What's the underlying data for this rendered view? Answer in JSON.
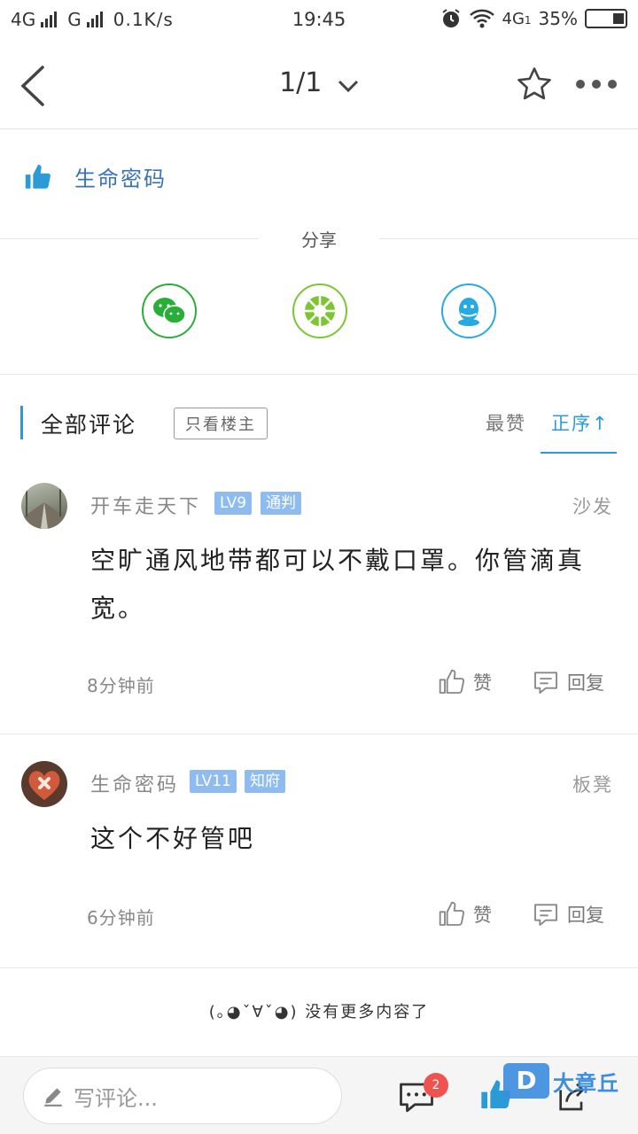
{
  "status_bar": {
    "network_1": "4G",
    "network_2": "G",
    "speed": "0.1K/s",
    "time": "19:45",
    "network_3": "4G",
    "sim_index": "1",
    "battery": "35%"
  },
  "top_bar": {
    "pager": "1/1"
  },
  "liked_by": {
    "name": "生命密码"
  },
  "share": {
    "label": "分享",
    "targets": [
      {
        "icon": "wechat-icon",
        "color": "#2aae3a"
      },
      {
        "icon": "moments-icon",
        "color": "#7cc633"
      },
      {
        "icon": "qq-icon",
        "color": "#27aae1"
      }
    ]
  },
  "comments_header": {
    "title": "全部评论",
    "only_op": "只看楼主",
    "sort_likes": "最赞",
    "sort_order": "正序↑",
    "accent": "#2b9bd8"
  },
  "comments": [
    {
      "username": "开车走天下",
      "level": "LV9",
      "rank": "通判",
      "floor": "沙发",
      "text": "空旷通风地带都可以不戴口罩。你管滴真宽。",
      "time": "8分钟前",
      "like_label": "赞",
      "reply_label": "回复"
    },
    {
      "username": "生命密码",
      "level": "LV11",
      "rank": "知府",
      "floor": "板凳",
      "text": "这个不好管吧",
      "time": "6分钟前",
      "like_label": "赞",
      "reply_label": "回复"
    }
  ],
  "end_message": "(｡◕ˇ∀ˇ◕) 没有更多内容了",
  "bottom_bar": {
    "input_placeholder": "写评论...",
    "comment_count": "2"
  },
  "watermark": {
    "logo": "D",
    "text": "大章丘"
  }
}
